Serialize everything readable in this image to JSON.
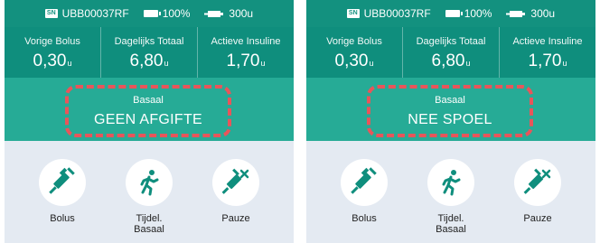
{
  "screens": [
    {
      "status": {
        "sn_badge": "SN",
        "serial": "UBB00037RF",
        "battery": "100%",
        "reservoir": "300u"
      },
      "stats": [
        {
          "label": "Vorige Bolus",
          "value": "0,30",
          "unit": "u"
        },
        {
          "label": "Dagelijks Totaal",
          "value": "6,80",
          "unit": "u"
        },
        {
          "label": "Actieve Insuline",
          "value": "1,70",
          "unit": "u"
        }
      ],
      "basal": {
        "label": "Basaal",
        "value": "GEEN AFGIFTE"
      },
      "actions": [
        {
          "label": "Bolus",
          "label2": ""
        },
        {
          "label": "Tijdel.",
          "label2": "Basaal"
        },
        {
          "label": "Pauze",
          "label2": ""
        }
      ]
    },
    {
      "status": {
        "sn_badge": "SN",
        "serial": "UBB00037RF",
        "battery": "100%",
        "reservoir": "300u"
      },
      "stats": [
        {
          "label": "Vorige Bolus",
          "value": "0,30",
          "unit": "u"
        },
        {
          "label": "Dagelijks Totaal",
          "value": "6,80",
          "unit": "u"
        },
        {
          "label": "Actieve Insuline",
          "value": "1,70",
          "unit": "u"
        }
      ],
      "basal": {
        "label": "Basaal",
        "value": "NEE SPOEL"
      },
      "actions": [
        {
          "label": "Bolus",
          "label2": ""
        },
        {
          "label": "Tijdel.",
          "label2": "Basaal"
        },
        {
          "label": "Pauze",
          "label2": ""
        }
      ]
    }
  ],
  "colors": {
    "header": "#13917f",
    "stats_bg": "#0f8e7d",
    "basal_bg": "#26ab96",
    "highlight": "#e8555a",
    "actions_bg": "#e4eaf2"
  },
  "icons": [
    "sn-badge-icon",
    "battery-icon",
    "reservoir-icon",
    "syringe-icon",
    "running-person-icon",
    "syringe-pause-icon"
  ]
}
